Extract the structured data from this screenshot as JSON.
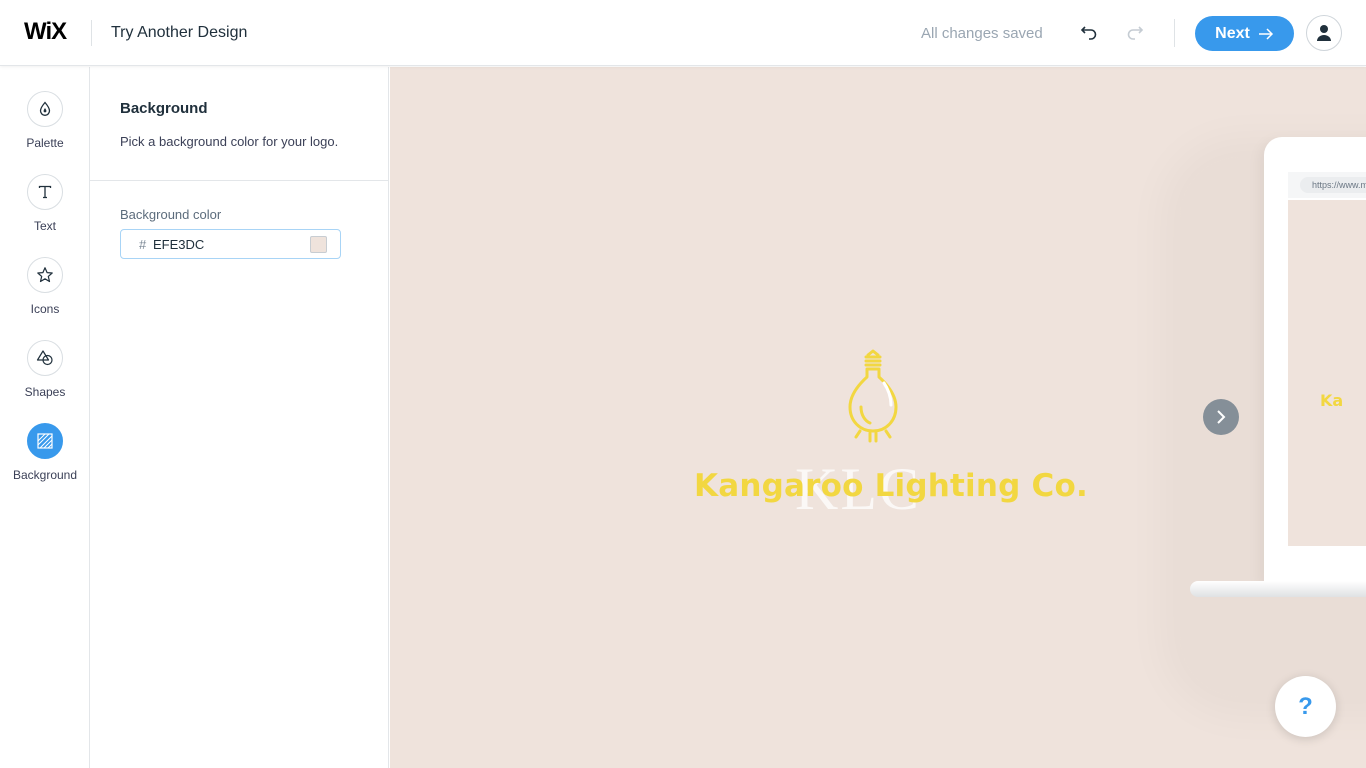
{
  "header": {
    "logo": "WiX",
    "title": "Try Another Design",
    "save_status": "All changes saved",
    "next_label": "Next",
    "undo_icon": "undo-icon",
    "redo_icon": "redo-icon"
  },
  "tools": [
    {
      "label": "Palette",
      "icon": "palette-drop-icon"
    },
    {
      "label": "Text",
      "icon": "text-t-icon"
    },
    {
      "label": "Icons",
      "icon": "star-icon"
    },
    {
      "label": "Shapes",
      "icon": "shapes-icon"
    },
    {
      "label": "Background",
      "icon": "background-hatch-icon",
      "active": true
    }
  ],
  "panel": {
    "title": "Background",
    "description": "Pick a background color for your logo.",
    "field_label": "Background color",
    "hash": "#",
    "color_value": "EFE3DC"
  },
  "canvas": {
    "background": "#efe3dc",
    "monogram": "KLC",
    "brand_name": "Kangaroo Lighting Co.",
    "brand_color": "#f2d741",
    "mock_url": "https://www.m",
    "mock_text": "Ka",
    "help_label": "?"
  },
  "colors": {
    "accent": "#3899ec"
  }
}
